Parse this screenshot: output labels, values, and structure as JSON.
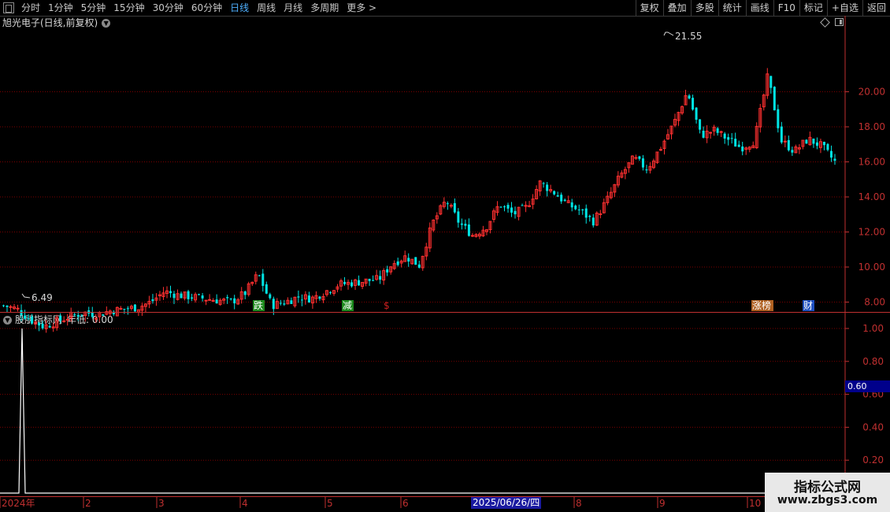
{
  "toolbar": {
    "periods": [
      "分时",
      "1分钟",
      "5分钟",
      "15分钟",
      "30分钟",
      "60分钟",
      "日线",
      "周线",
      "月线",
      "多周期",
      "更多 >"
    ],
    "active_period": "日线",
    "right_buttons": [
      "复权",
      "叠加",
      "多股",
      "统计",
      "画线",
      "F10",
      "标记",
      "+自选",
      "返回"
    ]
  },
  "chart_title": "旭光电子(日线,前复权)",
  "indicator_title": "股朋指标网",
  "indicator_value": "年低: 0.00",
  "price_axis": [
    "20.00",
    "18.00",
    "16.00",
    "14.00",
    "12.00",
    "10.00",
    "8.00"
  ],
  "indicator_axis": [
    "1.00",
    "0.80",
    "0.60",
    "0.40",
    "0.20"
  ],
  "price_tag": "0.60",
  "annotations": {
    "high": "21.55",
    "low": "6.49",
    "markers": [
      {
        "text": "跌",
        "color": "#1e8a1e"
      },
      {
        "text": "减",
        "color": "#1e8a1e"
      },
      {
        "text": "$",
        "color": "#d02020"
      },
      {
        "text": "涨榜",
        "color": "#b06020"
      },
      {
        "text": "财",
        "color": "#2050c0"
      }
    ]
  },
  "date_axis": {
    "labels": [
      "2024年",
      "2",
      "3",
      "4",
      "5",
      "6",
      "8",
      "9",
      "10"
    ],
    "cursor_date": "2025/06/26/四"
  },
  "watermark": {
    "title": "指标公式网",
    "url": "www.zbgs3.com"
  },
  "colors": {
    "up": "#ff3030",
    "down": "#00e5e5",
    "grid": "#7a0000",
    "axis": "#c03030"
  },
  "chart_data": {
    "type": "candlestick",
    "title": "旭光电子(日线,前复权)",
    "y_range": [
      6.0,
      22.0
    ],
    "period_high": 21.55,
    "period_low": 6.49,
    "approx_close_path": [
      7.8,
      7.6,
      7.0,
      6.6,
      6.9,
      7.2,
      7.4,
      7.3,
      7.5,
      7.6,
      7.7,
      8.0,
      8.6,
      8.4,
      8.3,
      8.2,
      8.1,
      8.0,
      8.5,
      9.6,
      7.8,
      8.0,
      8.3,
      8.2,
      8.6,
      9.0,
      9.1,
      9.2,
      9.3,
      10.2,
      10.6,
      10.1,
      12.5,
      13.8,
      12.5,
      11.8,
      12.3,
      13.6,
      13.0,
      13.4,
      14.8,
      14.3,
      13.6,
      13.2,
      12.6,
      13.8,
      15.2,
      16.2,
      15.6,
      16.8,
      18.2,
      20.0,
      17.5,
      17.8,
      17.3,
      16.8,
      17.2,
      20.9,
      17.2,
      16.6,
      17.3,
      16.9,
      16.0
    ],
    "indicator": {
      "name": "股朋指标网",
      "y_range": [
        0,
        1.05
      ],
      "values_note_free": [
        0,
        1,
        0
      ],
      "spike_value": 1.0
    }
  }
}
